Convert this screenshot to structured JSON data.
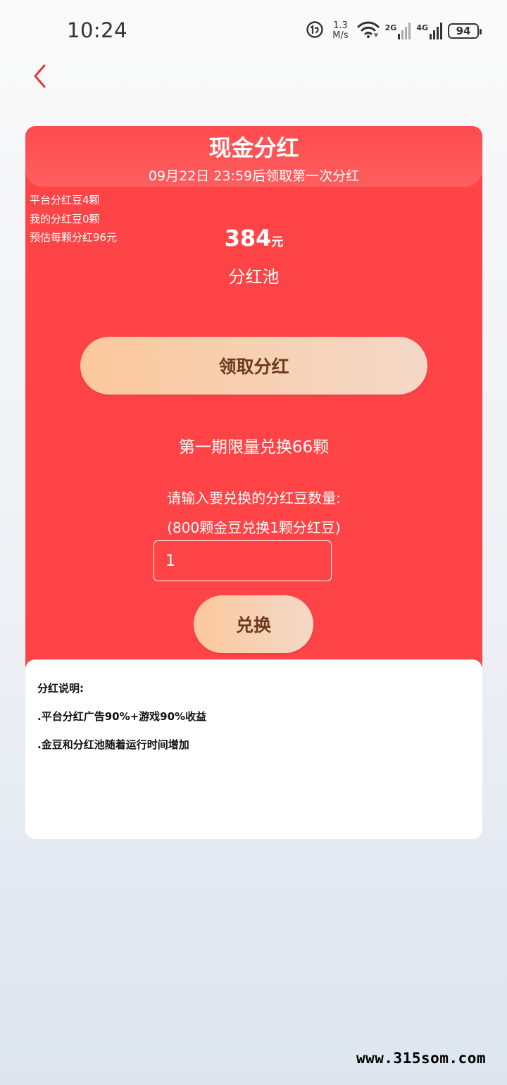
{
  "status_bar": {
    "time": "10:24",
    "speed_value": "1.3",
    "speed_unit": "M/s",
    "signal_1_label": "2G",
    "signal_2_label": "4G",
    "battery": "94"
  },
  "header": {
    "back_icon": "chevron-left-icon"
  },
  "dividend_card": {
    "title": "现金分红",
    "subtitle": "09月22日 23:59后领取第一次分红",
    "stats": {
      "platform_beans": "平台分红豆4颗",
      "my_beans": "我的分红豆0颗",
      "estimate": "预估每颗分红96元"
    },
    "pool_amount": "384",
    "pool_unit": "元",
    "pool_label": "分红池",
    "claim_button": "领取分红",
    "limit_text": "第一期限量兑换66颗",
    "prompt_text": "请输入要兑换的分红豆数量:",
    "rate_text": "(800颗金豆兑换1颗分红豆)",
    "quantity_value": "1",
    "exchange_button": "兑换"
  },
  "notes": {
    "title": "分红说明:",
    "lines": [
      ".平台分红广告90%+游戏90%收益",
      ".金豆和分红池随着运行时间增加"
    ]
  },
  "watermark": "www.315som.com",
  "colors": {
    "card_red": "#fe4446",
    "button_gradient_start": "#fcc89d",
    "button_gradient_end": "#f3d8c7",
    "button_text": "#6b3c1c",
    "back_icon": "#e0393b"
  }
}
